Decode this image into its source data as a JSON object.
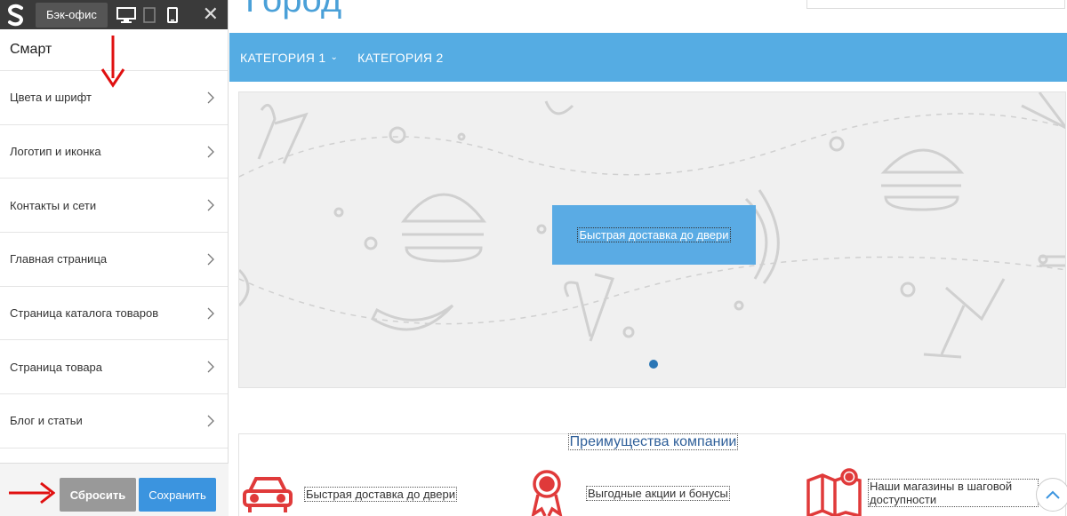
{
  "editor": {
    "backoffice_label": "Бэк-офис",
    "close_symbol": "✕",
    "panel_title": "Смарт",
    "menu": [
      {
        "label": "Цвета и шрифт"
      },
      {
        "label": "Логотип и иконка"
      },
      {
        "label": "Контакты и сети"
      },
      {
        "label": "Главная страница"
      },
      {
        "label": "Страница каталога товаров"
      },
      {
        "label": "Страница товара"
      },
      {
        "label": "Блог и статьи"
      }
    ],
    "reset_label": "Сбросить",
    "save_label": "Сохранить"
  },
  "site": {
    "title": "Город",
    "nav": [
      {
        "label": "КАТЕГОРИЯ 1"
      },
      {
        "label": "КАТЕГОРИЯ 2"
      }
    ],
    "banner_text": "Быстрая доставка до двери",
    "advantages": {
      "title": "Преимущества компании",
      "items": [
        {
          "label": "Быстрая доставка до двери",
          "icon": "car-icon"
        },
        {
          "label": "Выгодные акции и бонусы",
          "icon": "award-icon"
        },
        {
          "label": "Наши магазины в шаговой доступности",
          "icon": "map-icon"
        }
      ]
    }
  },
  "colors": {
    "accent": "#55ace3",
    "save_button": "#3b94df",
    "reset_button": "#999999",
    "feature_icons": "#e03a3a",
    "annotation_arrows": "#e01010"
  }
}
